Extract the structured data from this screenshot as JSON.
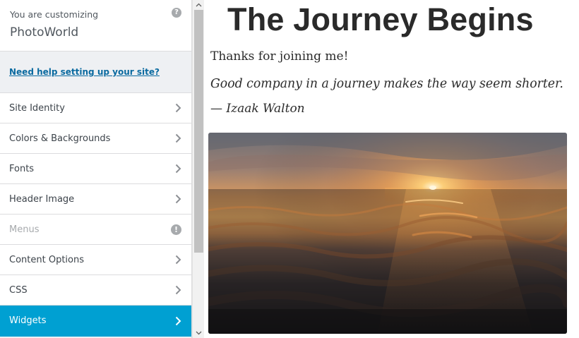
{
  "customizer": {
    "customizing_label": "You are customizing",
    "site_name": "PhotoWorld",
    "help_link": "Need help setting up your site?"
  },
  "menu": {
    "items": [
      {
        "label": "Site Identity",
        "state": "normal",
        "icon": "chevron-right-icon"
      },
      {
        "label": "Colors & Backgrounds",
        "state": "normal",
        "icon": "chevron-right-icon"
      },
      {
        "label": "Fonts",
        "state": "normal",
        "icon": "chevron-right-icon"
      },
      {
        "label": "Header Image",
        "state": "normal",
        "icon": "chevron-right-icon"
      },
      {
        "label": "Menus",
        "state": "disabled",
        "icon": "warning-icon"
      },
      {
        "label": "Content Options",
        "state": "normal",
        "icon": "chevron-right-icon"
      },
      {
        "label": "CSS",
        "state": "normal",
        "icon": "chevron-right-icon"
      },
      {
        "label": "Widgets",
        "state": "active",
        "icon": "chevron-right-icon"
      }
    ]
  },
  "preview": {
    "title": "The Journey Begins",
    "intro": "Thanks for joining me!",
    "quote": "Good company in a journey makes the way seem shorter.",
    "attribution": "— Izaak Walton"
  },
  "colors": {
    "accent": "#00a0d2",
    "link": "#0a6aa0",
    "panel_bg": "#eef0f3"
  }
}
